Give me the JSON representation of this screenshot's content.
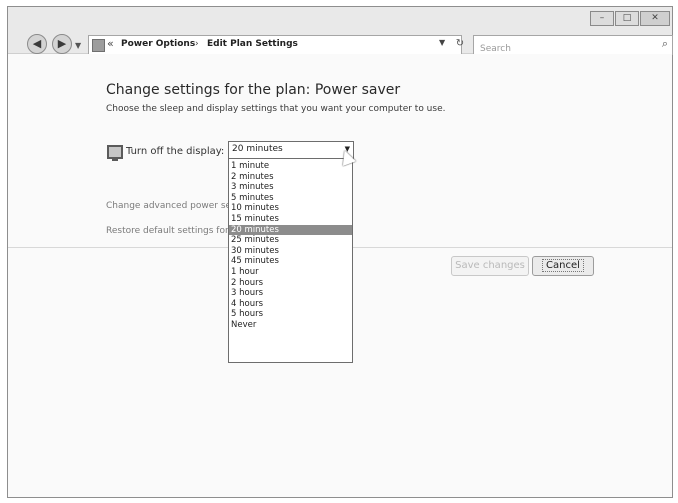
{
  "window": {
    "controls": {
      "minimize": "–",
      "maximize": "□",
      "close": "✕"
    }
  },
  "nav": {
    "back_icon": "back-arrow-icon",
    "forward_icon": "forward-arrow-icon",
    "dropdown_icon": "chevron-down-icon"
  },
  "address_bar": {
    "chevron": "«",
    "breadcrumbs": [
      "Power Options",
      "Edit Plan Settings"
    ],
    "separator": "›"
  },
  "search": {
    "placeholder": "Search"
  },
  "page": {
    "title": "Change settings for the plan: Power saver",
    "subtitle": "Choose the sleep and display settings that you want your computer to use.",
    "display_setting_label": "Turn off the display:",
    "display_selected": "20 minutes",
    "links": {
      "advanced": "Change advanced power settings",
      "restore": "Restore default settings for this plan"
    },
    "buttons": {
      "save": "Save changes",
      "cancel": "Cancel"
    }
  },
  "dropdown_options": [
    "1 minute",
    "2 minutes",
    "3 minutes",
    "5 minutes",
    "10 minutes",
    "15 minutes",
    "20 minutes",
    "25 minutes",
    "30 minutes",
    "45 minutes",
    "1 hour",
    "2 hours",
    "3 hours",
    "4 hours",
    "5 hours",
    "Never"
  ],
  "selected_index": 6
}
